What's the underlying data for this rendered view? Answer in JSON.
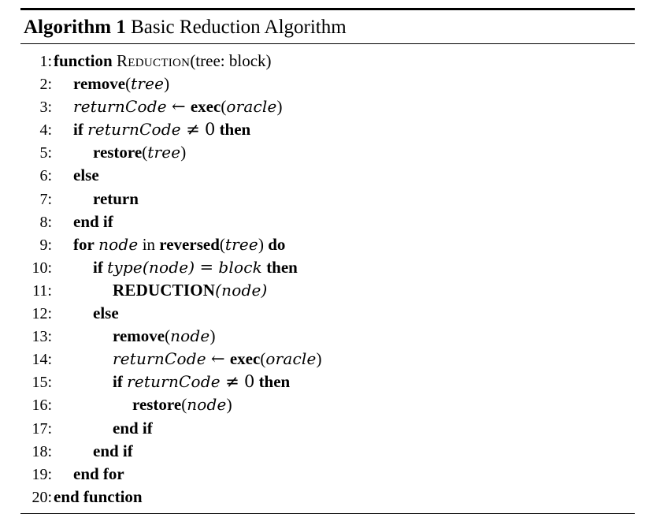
{
  "document": {
    "kind": "algorithm-float",
    "background_color": "#ffffff",
    "text_color": "#000000"
  },
  "caption": {
    "label": "Algorithm 1",
    "separator": " ",
    "title": "Basic Reduction Algorithm",
    "full_text": "Algorithm 1 Basic Reduction Algorithm"
  },
  "rules": {
    "top": "thick",
    "under_caption": "thin",
    "bottom": "thin"
  },
  "listing": {
    "line_number_suffix": ":",
    "lines": [
      {
        "number": "1:",
        "indent": 0,
        "plain": "function REDUCTION(tree: block)",
        "tokens": [
          {
            "kind": "kw",
            "text": "function"
          },
          {
            "kind": "sp",
            "text": " "
          },
          {
            "kind": "sc",
            "text": "Reduction"
          },
          {
            "kind": "roman",
            "text": "(tree: block)"
          }
        ]
      },
      {
        "number": "2:",
        "indent": 1,
        "plain": "remove(tree)",
        "tokens": [
          {
            "kind": "kw",
            "text": "remove"
          },
          {
            "kind": "roman",
            "text": "("
          },
          {
            "kind": "math",
            "text": "tree"
          },
          {
            "kind": "roman",
            "text": ")"
          }
        ]
      },
      {
        "number": "3:",
        "indent": 1,
        "plain": "returnCode ← exec(oracle)",
        "tokens": [
          {
            "kind": "math",
            "text": "returnCode"
          },
          {
            "kind": "sp",
            "text": " "
          },
          {
            "kind": "op",
            "text": "←"
          },
          {
            "kind": "sp",
            "text": " "
          },
          {
            "kind": "kw",
            "text": "exec"
          },
          {
            "kind": "roman",
            "text": "("
          },
          {
            "kind": "math",
            "text": "oracle"
          },
          {
            "kind": "roman",
            "text": ")"
          }
        ]
      },
      {
        "number": "4:",
        "indent": 1,
        "plain": "if returnCode ≠ 0 then",
        "tokens": [
          {
            "kind": "kw",
            "text": "if"
          },
          {
            "kind": "sp",
            "text": " "
          },
          {
            "kind": "math",
            "text": "returnCode"
          },
          {
            "kind": "sp",
            "text": " "
          },
          {
            "kind": "op",
            "text": "≠"
          },
          {
            "kind": "sp",
            "text": " "
          },
          {
            "kind": "num",
            "text": "0"
          },
          {
            "kind": "sp",
            "text": " "
          },
          {
            "kind": "kw",
            "text": "then"
          }
        ]
      },
      {
        "number": "5:",
        "indent": 2,
        "plain": "restore(tree)",
        "tokens": [
          {
            "kind": "kw",
            "text": "restore"
          },
          {
            "kind": "roman",
            "text": "("
          },
          {
            "kind": "math",
            "text": "tree"
          },
          {
            "kind": "roman",
            "text": ")"
          }
        ]
      },
      {
        "number": "6:",
        "indent": 1,
        "plain": "else",
        "tokens": [
          {
            "kind": "kw",
            "text": "else"
          }
        ]
      },
      {
        "number": "7:",
        "indent": 2,
        "plain": "return",
        "tokens": [
          {
            "kind": "kw",
            "text": "return"
          }
        ]
      },
      {
        "number": "8:",
        "indent": 1,
        "plain": "end if",
        "tokens": [
          {
            "kind": "kw",
            "text": "end if"
          }
        ]
      },
      {
        "number": "9:",
        "indent": 1,
        "plain": "for node in reversed(tree) do",
        "tokens": [
          {
            "kind": "kw",
            "text": "for"
          },
          {
            "kind": "sp",
            "text": " "
          },
          {
            "kind": "math",
            "text": "node"
          },
          {
            "kind": "sp",
            "text": " "
          },
          {
            "kind": "roman",
            "text": "in"
          },
          {
            "kind": "sp",
            "text": " "
          },
          {
            "kind": "kw",
            "text": "reversed"
          },
          {
            "kind": "roman",
            "text": "("
          },
          {
            "kind": "math",
            "text": "tree"
          },
          {
            "kind": "roman",
            "text": ")"
          },
          {
            "kind": "sp",
            "text": " "
          },
          {
            "kind": "kw",
            "text": "do"
          }
        ]
      },
      {
        "number": "10:",
        "indent": 2,
        "plain": "if type(node) = block then",
        "tokens": [
          {
            "kind": "kw",
            "text": "if"
          },
          {
            "kind": "sp",
            "text": " "
          },
          {
            "kind": "math",
            "text": "type"
          },
          {
            "kind": "math",
            "text": "("
          },
          {
            "kind": "math",
            "text": "node"
          },
          {
            "kind": "math",
            "text": ")"
          },
          {
            "kind": "sp",
            "text": " "
          },
          {
            "kind": "op",
            "text": "="
          },
          {
            "kind": "sp",
            "text": " "
          },
          {
            "kind": "math",
            "text": "block"
          },
          {
            "kind": "sp",
            "text": " "
          },
          {
            "kind": "kw",
            "text": "then"
          }
        ]
      },
      {
        "number": "11:",
        "indent": 3,
        "plain": "REDUCTION(node)",
        "tokens": [
          {
            "kind": "scb",
            "text": "REDUCTION"
          },
          {
            "kind": "math",
            "text": "("
          },
          {
            "kind": "math",
            "text": "node"
          },
          {
            "kind": "math",
            "text": ")"
          }
        ]
      },
      {
        "number": "12:",
        "indent": 2,
        "plain": "else",
        "tokens": [
          {
            "kind": "kw",
            "text": "else"
          }
        ]
      },
      {
        "number": "13:",
        "indent": 3,
        "plain": "remove(node)",
        "tokens": [
          {
            "kind": "kw",
            "text": "remove"
          },
          {
            "kind": "roman",
            "text": "("
          },
          {
            "kind": "math",
            "text": "node"
          },
          {
            "kind": "roman",
            "text": ")"
          }
        ]
      },
      {
        "number": "14:",
        "indent": 3,
        "plain": "returnCode ← exec(oracle)",
        "tokens": [
          {
            "kind": "math",
            "text": "returnCode"
          },
          {
            "kind": "sp",
            "text": " "
          },
          {
            "kind": "op",
            "text": "←"
          },
          {
            "kind": "sp",
            "text": " "
          },
          {
            "kind": "kw",
            "text": "exec"
          },
          {
            "kind": "roman",
            "text": "("
          },
          {
            "kind": "math",
            "text": "oracle"
          },
          {
            "kind": "roman",
            "text": ")"
          }
        ]
      },
      {
        "number": "15:",
        "indent": 3,
        "plain": "if returnCode ≠ 0 then",
        "tokens": [
          {
            "kind": "kw",
            "text": "if"
          },
          {
            "kind": "sp",
            "text": " "
          },
          {
            "kind": "math",
            "text": "returnCode"
          },
          {
            "kind": "sp",
            "text": " "
          },
          {
            "kind": "op",
            "text": "≠"
          },
          {
            "kind": "sp",
            "text": " "
          },
          {
            "kind": "num",
            "text": "0"
          },
          {
            "kind": "sp",
            "text": " "
          },
          {
            "kind": "kw",
            "text": "then"
          }
        ]
      },
      {
        "number": "16:",
        "indent": 4,
        "plain": "restore(node)",
        "tokens": [
          {
            "kind": "kw",
            "text": "restore"
          },
          {
            "kind": "roman",
            "text": "("
          },
          {
            "kind": "math",
            "text": "node"
          },
          {
            "kind": "roman",
            "text": ")"
          }
        ]
      },
      {
        "number": "17:",
        "indent": 3,
        "plain": "end if",
        "tokens": [
          {
            "kind": "kw",
            "text": "end if"
          }
        ]
      },
      {
        "number": "18:",
        "indent": 2,
        "plain": "end if",
        "tokens": [
          {
            "kind": "kw",
            "text": "end if"
          }
        ]
      },
      {
        "number": "19:",
        "indent": 1,
        "plain": "end for",
        "tokens": [
          {
            "kind": "kw",
            "text": "end for"
          }
        ]
      },
      {
        "number": "20:",
        "indent": 0,
        "plain": "end function",
        "tokens": [
          {
            "kind": "kw",
            "text": "end function"
          }
        ]
      }
    ]
  }
}
